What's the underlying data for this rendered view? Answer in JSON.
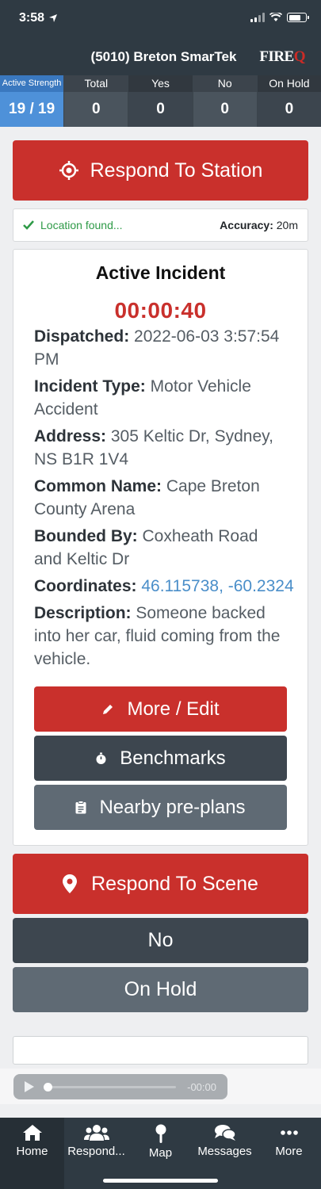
{
  "status_bar": {
    "time": "3:58"
  },
  "header": {
    "title": "(5010) Breton SmarTek",
    "logo_main": "FIRE",
    "logo_q": "Q"
  },
  "stats": [
    {
      "label": "Active Strength",
      "value": "19 / 19"
    },
    {
      "label": "Total",
      "value": "0"
    },
    {
      "label": "Yes",
      "value": "0"
    },
    {
      "label": "No",
      "value": "0"
    },
    {
      "label": "On Hold",
      "value": "0"
    }
  ],
  "respond_station_label": "Respond To Station",
  "location": {
    "status": "Location found...",
    "accuracy_label": "Accuracy:",
    "accuracy_value": "20m"
  },
  "incident": {
    "title": "Active Incident",
    "timer": "00:00:40",
    "dispatched_label": "Dispatched:",
    "dispatched_value": "2022-06-03 3:57:54 PM",
    "type_label": "Incident Type:",
    "type_value": "Motor Vehicle Accident",
    "address_label": "Address:",
    "address_value": "305 Keltic Dr, Sydney, NS B1R 1V4",
    "common_name_label": "Common Name:",
    "common_name_value": "Cape Breton County Arena",
    "bounded_label": "Bounded By:",
    "bounded_value": "Coxheath Road and Keltic Dr",
    "coordinates_label": "Coordinates:",
    "coordinates_value": "46.115738, -60.2324",
    "description_label": "Description:",
    "description_value": "Someone backed into her car, fluid coming from the vehicle.",
    "buttons": {
      "edit": "More / Edit",
      "benchmarks": "Benchmarks",
      "preplans": "Nearby pre-plans"
    }
  },
  "respond_scene_label": "Respond To Scene",
  "no_label": "No",
  "on_hold_label": "On Hold",
  "player": {
    "time": "-00:00"
  },
  "tabs": [
    {
      "label": "Home",
      "icon": "home-icon"
    },
    {
      "label": "Respond...",
      "icon": "people-icon"
    },
    {
      "label": "Map",
      "icon": "pin-icon"
    },
    {
      "label": "Messages",
      "icon": "chat-icon"
    },
    {
      "label": "More",
      "icon": "dots-icon"
    }
  ],
  "colors": {
    "accent_red": "#c9302c",
    "accent_blue": "#4e91d9",
    "header": "#2f3a43",
    "success": "#2e9a47"
  }
}
